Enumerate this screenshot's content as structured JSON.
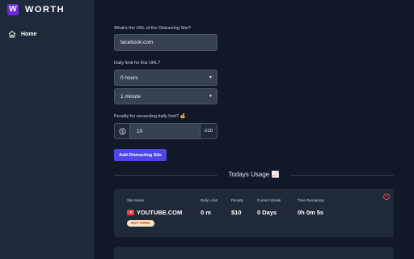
{
  "brand": {
    "logo_letter": "W",
    "name": "WORTH",
    "accent": "#6d28d9"
  },
  "nav": {
    "items": [
      {
        "label": "Home",
        "icon": "home-icon"
      }
    ]
  },
  "form": {
    "url_label": "What's the URL of the Distracting Site?",
    "url_value": "facebook.com",
    "limit_label": "Daily limit for this URL?",
    "hours_value": "0 hours",
    "minutes_value": "1 minute",
    "penalty_label": "Penalty for exceeding daily limit? 💰",
    "penalty_value": "10",
    "penalty_currency_icon": "dollar-circle-icon",
    "penalty_suffix": "USD",
    "add_button": "Add Distracting Site",
    "button_color": "#4f46e5"
  },
  "usage": {
    "title": "Todays Usage 📈",
    "columns": {
      "site": "Site Name",
      "limit": "Daily Limit",
      "penalty": "Penalty",
      "streak": "Current Streak",
      "remaining": "Time Remaining"
    },
    "rows": [
      {
        "site_icon": "youtube-icon",
        "site": "YOUTUBE.COM",
        "status": "NOT OPEN",
        "limit": "0 m",
        "penalty": "$10",
        "streak": "0 Days",
        "remaining": "0h 0m 5s"
      }
    ]
  }
}
